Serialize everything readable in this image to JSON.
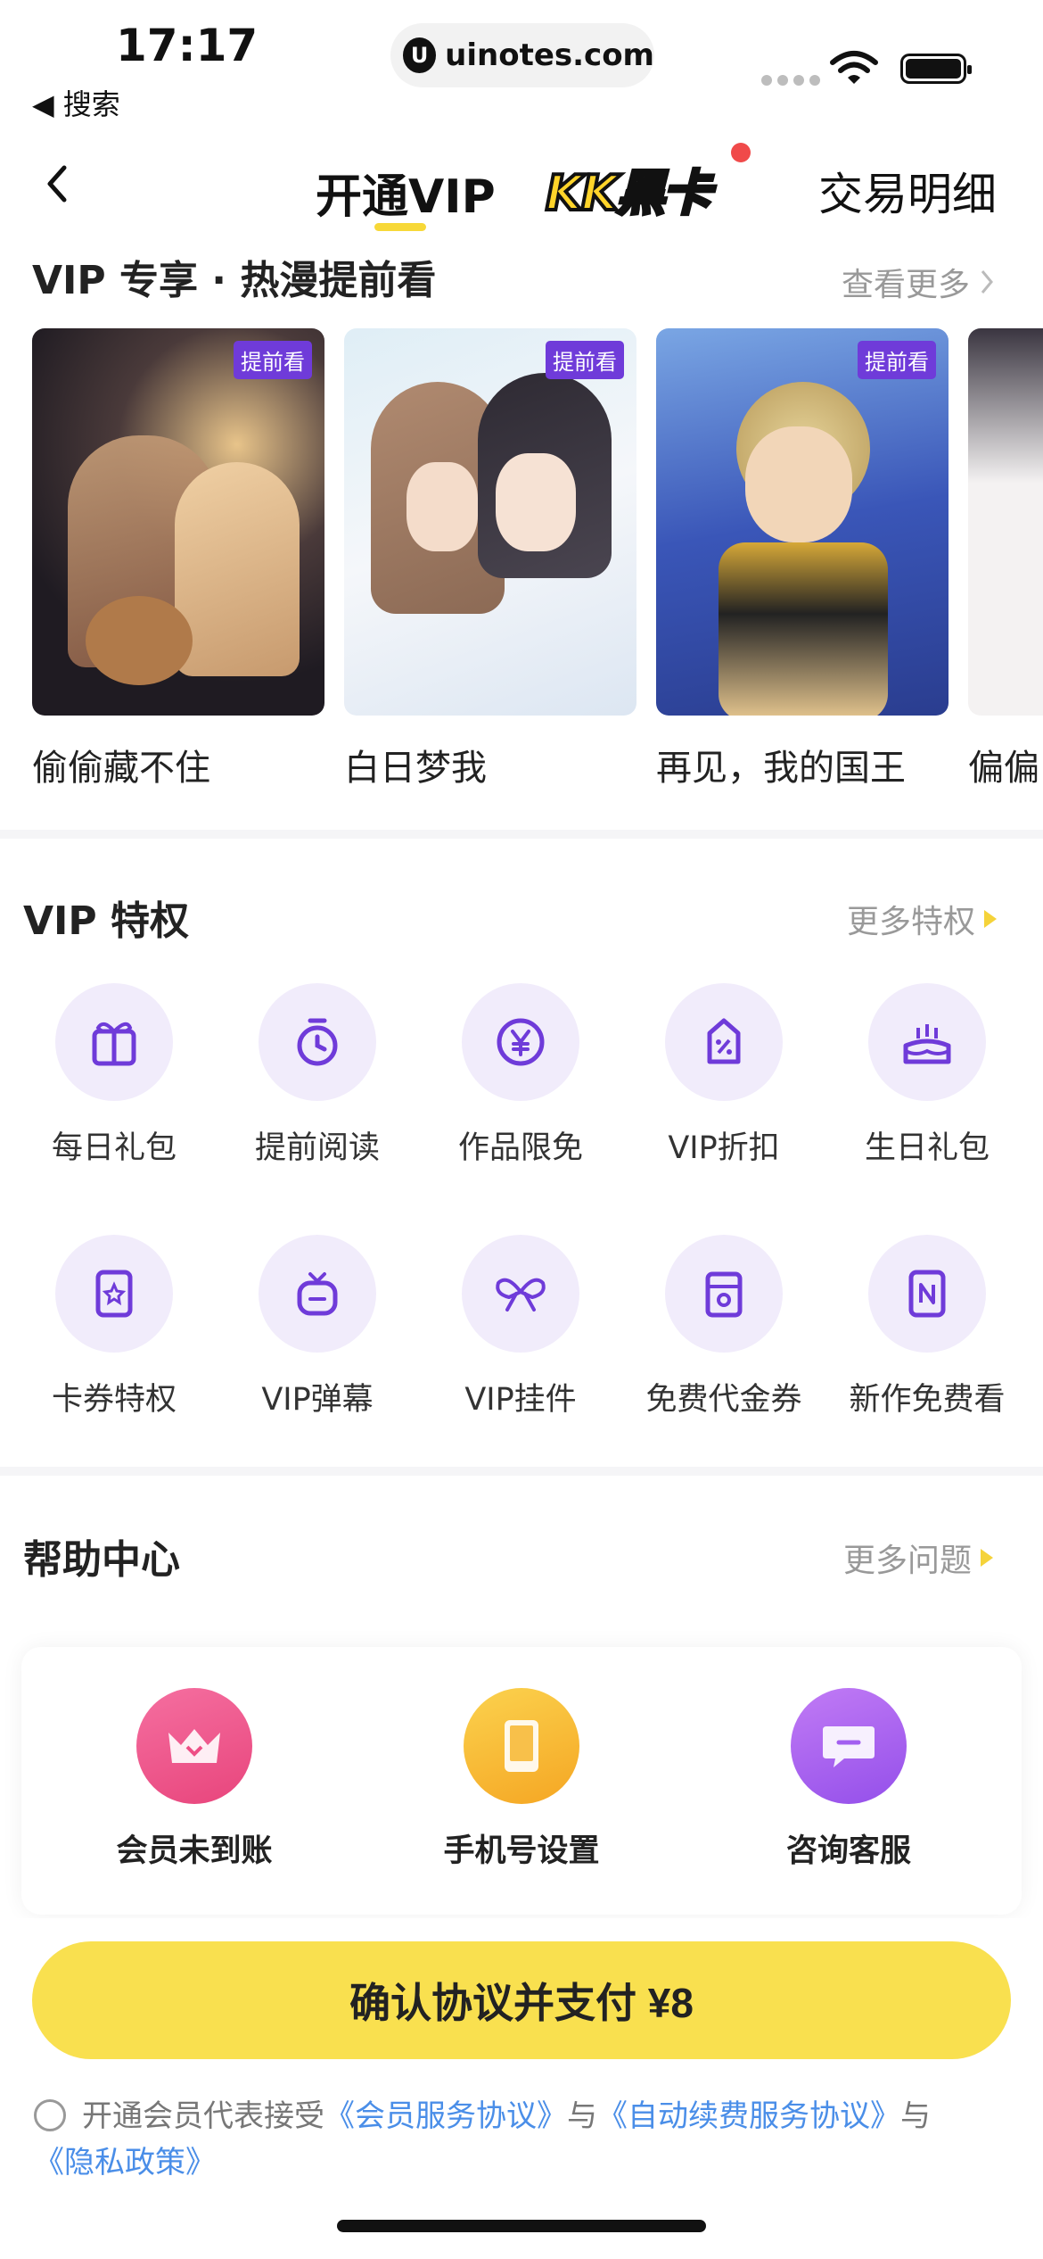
{
  "status_bar": {
    "time": "17:17",
    "back_label": "◀ 搜索",
    "url": "uinotes.com",
    "url_logo": "U"
  },
  "nav": {
    "back_icon": "chevron-left-icon",
    "tab_vip": "开通VIP",
    "tab_kk": "KK黑卡",
    "tab_detail": "交易明细"
  },
  "preview": {
    "title": "VIP 专享 · 热漫提前看",
    "more": "查看更多",
    "badge": "提前看",
    "comics": [
      {
        "title": "偷偷藏不住",
        "badge": "提前看"
      },
      {
        "title": "白日梦我",
        "badge": "提前看"
      },
      {
        "title": "再见，我的国王",
        "badge": "提前看"
      },
      {
        "title": "偏偏",
        "badge": ""
      }
    ]
  },
  "privileges": {
    "title": "VIP 特权",
    "more": "更多特权",
    "items": [
      {
        "label": "每日礼包",
        "icon": "gift-icon"
      },
      {
        "label": "提前阅读",
        "icon": "stopwatch-icon"
      },
      {
        "label": "作品限免",
        "icon": "yen-icon"
      },
      {
        "label": "VIP折扣",
        "icon": "discount-tag-icon"
      },
      {
        "label": "生日礼包",
        "icon": "birthday-cake-icon"
      },
      {
        "label": "卡券特权",
        "icon": "coupon-star-icon"
      },
      {
        "label": "VIP弹幕",
        "icon": "danmaku-bag-icon"
      },
      {
        "label": "VIP挂件",
        "icon": "bow-icon"
      },
      {
        "label": "免费代金券",
        "icon": "voucher-icon"
      },
      {
        "label": "新作免费看",
        "icon": "new-ticket-icon"
      }
    ]
  },
  "help": {
    "title": "帮助中心",
    "more": "更多问题",
    "items": [
      {
        "label": "会员未到账",
        "icon": "crown-icon",
        "color": "#ee4f86"
      },
      {
        "label": "手机号设置",
        "icon": "phone-icon",
        "color": "#f7b52e"
      },
      {
        "label": "咨询客服",
        "icon": "chat-icon",
        "color": "#a35ff0"
      }
    ]
  },
  "payment": {
    "button_label": "确认协议并支付  ¥8",
    "agreement_prefix": "开通会员代表接受",
    "link_member": "《会员服务协议》",
    "and1": "与",
    "link_auto": "《自动续费服务协议》",
    "and2": "与",
    "link_privacy": "《隐私政策》"
  },
  "colors": {
    "accent_yellow": "#f9e04f",
    "purple": "#6f3bd9",
    "link_blue": "#4a8ee8"
  }
}
